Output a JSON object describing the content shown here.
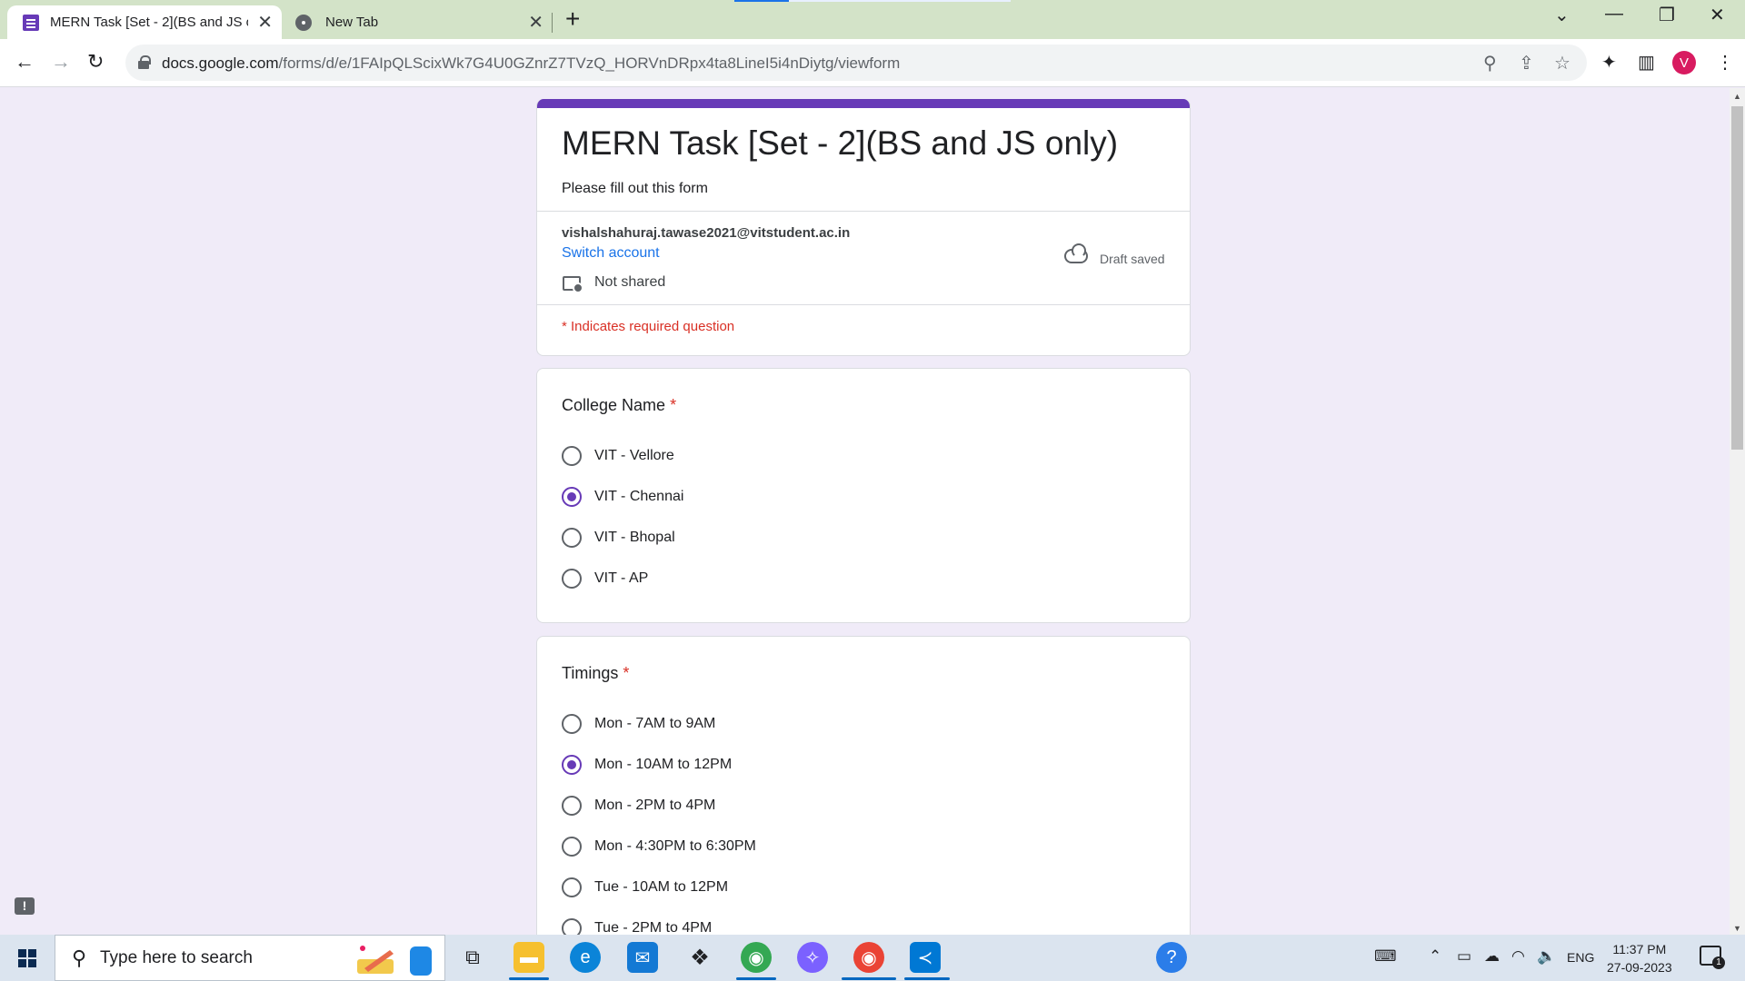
{
  "browser": {
    "tabs": [
      {
        "title": "MERN Task [Set - 2](BS and JS only)",
        "active": true,
        "icon": "google-forms-icon"
      },
      {
        "title": "New Tab",
        "active": false,
        "icon": "chrome-icon"
      }
    ],
    "url_host": "docs.google.com",
    "url_path": "/forms/d/e/1FAIpQLScixWk7G4U0GZnrZ7TVzQ_HORVnDRpx4ta8LineI5i4nDiytg/viewform",
    "profile_initial": "V"
  },
  "form": {
    "accent_color": "#673ab7",
    "title": "MERN Task [Set - 2](BS and JS only)",
    "description": "Please fill out this form",
    "account_email": "vishalshahuraj.tawase2021@vitstudent.ac.in",
    "switch_account": "Switch account",
    "not_shared": "Not shared",
    "draft_status": "Draft saved",
    "required_note": "* Indicates required question",
    "questions": [
      {
        "title": "College Name",
        "required_mark": "*",
        "options": [
          "VIT - Vellore",
          "VIT - Chennai",
          "VIT - Bhopal",
          "VIT - AP"
        ],
        "selected": "VIT - Chennai"
      },
      {
        "title": "Timings",
        "required_mark": "*",
        "options": [
          "Mon - 7AM to 9AM",
          "Mon - 10AM to 12PM",
          "Mon - 2PM to 4PM",
          "Mon - 4:30PM to 6:30PM",
          "Tue - 10AM to 12PM",
          "Tue - 2PM to 4PM"
        ],
        "selected": "Mon - 10AM to 12PM"
      }
    ]
  },
  "taskbar": {
    "search_placeholder": "Type here to search",
    "language": "ENG",
    "time": "11:37 PM",
    "date": "27-09-2023",
    "notification_count": "1"
  }
}
